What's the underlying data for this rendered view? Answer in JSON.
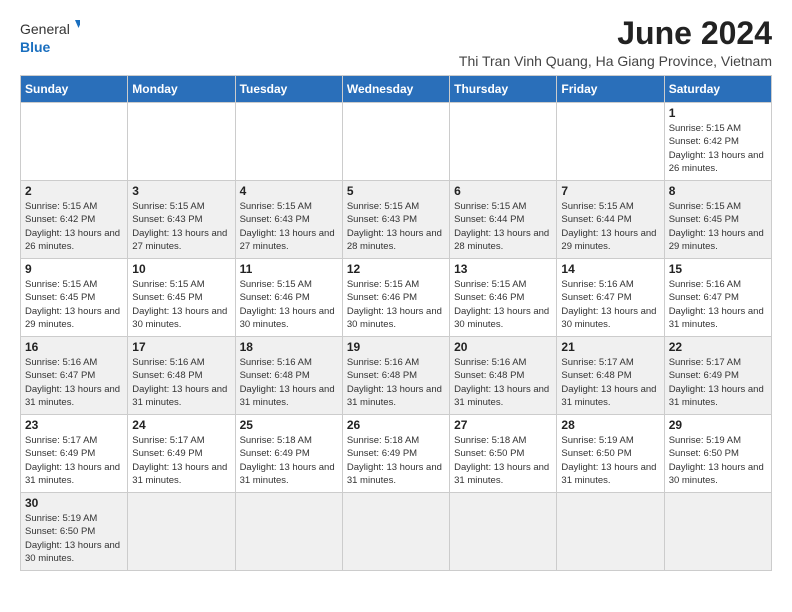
{
  "header": {
    "logo_general": "General",
    "logo_blue": "Blue",
    "month_year": "June 2024",
    "location": "Thi Tran Vinh Quang, Ha Giang Province, Vietnam"
  },
  "weekdays": [
    "Sunday",
    "Monday",
    "Tuesday",
    "Wednesday",
    "Thursday",
    "Friday",
    "Saturday"
  ],
  "weeks": [
    [
      {
        "day": "",
        "info": ""
      },
      {
        "day": "",
        "info": ""
      },
      {
        "day": "",
        "info": ""
      },
      {
        "day": "",
        "info": ""
      },
      {
        "day": "",
        "info": ""
      },
      {
        "day": "",
        "info": ""
      },
      {
        "day": "1",
        "info": "Sunrise: 5:15 AM\nSunset: 6:42 PM\nDaylight: 13 hours and 26 minutes."
      }
    ],
    [
      {
        "day": "2",
        "info": "Sunrise: 5:15 AM\nSunset: 6:42 PM\nDaylight: 13 hours and 26 minutes."
      },
      {
        "day": "3",
        "info": "Sunrise: 5:15 AM\nSunset: 6:43 PM\nDaylight: 13 hours and 27 minutes."
      },
      {
        "day": "4",
        "info": "Sunrise: 5:15 AM\nSunset: 6:43 PM\nDaylight: 13 hours and 27 minutes."
      },
      {
        "day": "5",
        "info": "Sunrise: 5:15 AM\nSunset: 6:43 PM\nDaylight: 13 hours and 28 minutes."
      },
      {
        "day": "6",
        "info": "Sunrise: 5:15 AM\nSunset: 6:44 PM\nDaylight: 13 hours and 28 minutes."
      },
      {
        "day": "7",
        "info": "Sunrise: 5:15 AM\nSunset: 6:44 PM\nDaylight: 13 hours and 29 minutes."
      },
      {
        "day": "8",
        "info": "Sunrise: 5:15 AM\nSunset: 6:45 PM\nDaylight: 13 hours and 29 minutes."
      }
    ],
    [
      {
        "day": "9",
        "info": "Sunrise: 5:15 AM\nSunset: 6:45 PM\nDaylight: 13 hours and 29 minutes."
      },
      {
        "day": "10",
        "info": "Sunrise: 5:15 AM\nSunset: 6:45 PM\nDaylight: 13 hours and 30 minutes."
      },
      {
        "day": "11",
        "info": "Sunrise: 5:15 AM\nSunset: 6:46 PM\nDaylight: 13 hours and 30 minutes."
      },
      {
        "day": "12",
        "info": "Sunrise: 5:15 AM\nSunset: 6:46 PM\nDaylight: 13 hours and 30 minutes."
      },
      {
        "day": "13",
        "info": "Sunrise: 5:15 AM\nSunset: 6:46 PM\nDaylight: 13 hours and 30 minutes."
      },
      {
        "day": "14",
        "info": "Sunrise: 5:16 AM\nSunset: 6:47 PM\nDaylight: 13 hours and 30 minutes."
      },
      {
        "day": "15",
        "info": "Sunrise: 5:16 AM\nSunset: 6:47 PM\nDaylight: 13 hours and 31 minutes."
      }
    ],
    [
      {
        "day": "16",
        "info": "Sunrise: 5:16 AM\nSunset: 6:47 PM\nDaylight: 13 hours and 31 minutes."
      },
      {
        "day": "17",
        "info": "Sunrise: 5:16 AM\nSunset: 6:48 PM\nDaylight: 13 hours and 31 minutes."
      },
      {
        "day": "18",
        "info": "Sunrise: 5:16 AM\nSunset: 6:48 PM\nDaylight: 13 hours and 31 minutes."
      },
      {
        "day": "19",
        "info": "Sunrise: 5:16 AM\nSunset: 6:48 PM\nDaylight: 13 hours and 31 minutes."
      },
      {
        "day": "20",
        "info": "Sunrise: 5:16 AM\nSunset: 6:48 PM\nDaylight: 13 hours and 31 minutes."
      },
      {
        "day": "21",
        "info": "Sunrise: 5:17 AM\nSunset: 6:48 PM\nDaylight: 13 hours and 31 minutes."
      },
      {
        "day": "22",
        "info": "Sunrise: 5:17 AM\nSunset: 6:49 PM\nDaylight: 13 hours and 31 minutes."
      }
    ],
    [
      {
        "day": "23",
        "info": "Sunrise: 5:17 AM\nSunset: 6:49 PM\nDaylight: 13 hours and 31 minutes."
      },
      {
        "day": "24",
        "info": "Sunrise: 5:17 AM\nSunset: 6:49 PM\nDaylight: 13 hours and 31 minutes."
      },
      {
        "day": "25",
        "info": "Sunrise: 5:18 AM\nSunset: 6:49 PM\nDaylight: 13 hours and 31 minutes."
      },
      {
        "day": "26",
        "info": "Sunrise: 5:18 AM\nSunset: 6:49 PM\nDaylight: 13 hours and 31 minutes."
      },
      {
        "day": "27",
        "info": "Sunrise: 5:18 AM\nSunset: 6:50 PM\nDaylight: 13 hours and 31 minutes."
      },
      {
        "day": "28",
        "info": "Sunrise: 5:19 AM\nSunset: 6:50 PM\nDaylight: 13 hours and 31 minutes."
      },
      {
        "day": "29",
        "info": "Sunrise: 5:19 AM\nSunset: 6:50 PM\nDaylight: 13 hours and 30 minutes."
      }
    ],
    [
      {
        "day": "30",
        "info": "Sunrise: 5:19 AM\nSunset: 6:50 PM\nDaylight: 13 hours and 30 minutes."
      },
      {
        "day": "",
        "info": ""
      },
      {
        "day": "",
        "info": ""
      },
      {
        "day": "",
        "info": ""
      },
      {
        "day": "",
        "info": ""
      },
      {
        "day": "",
        "info": ""
      },
      {
        "day": "",
        "info": ""
      }
    ]
  ],
  "colors": {
    "header_bg": "#2a6fba",
    "header_text": "#ffffff",
    "accent_blue": "#1a6fbf"
  }
}
